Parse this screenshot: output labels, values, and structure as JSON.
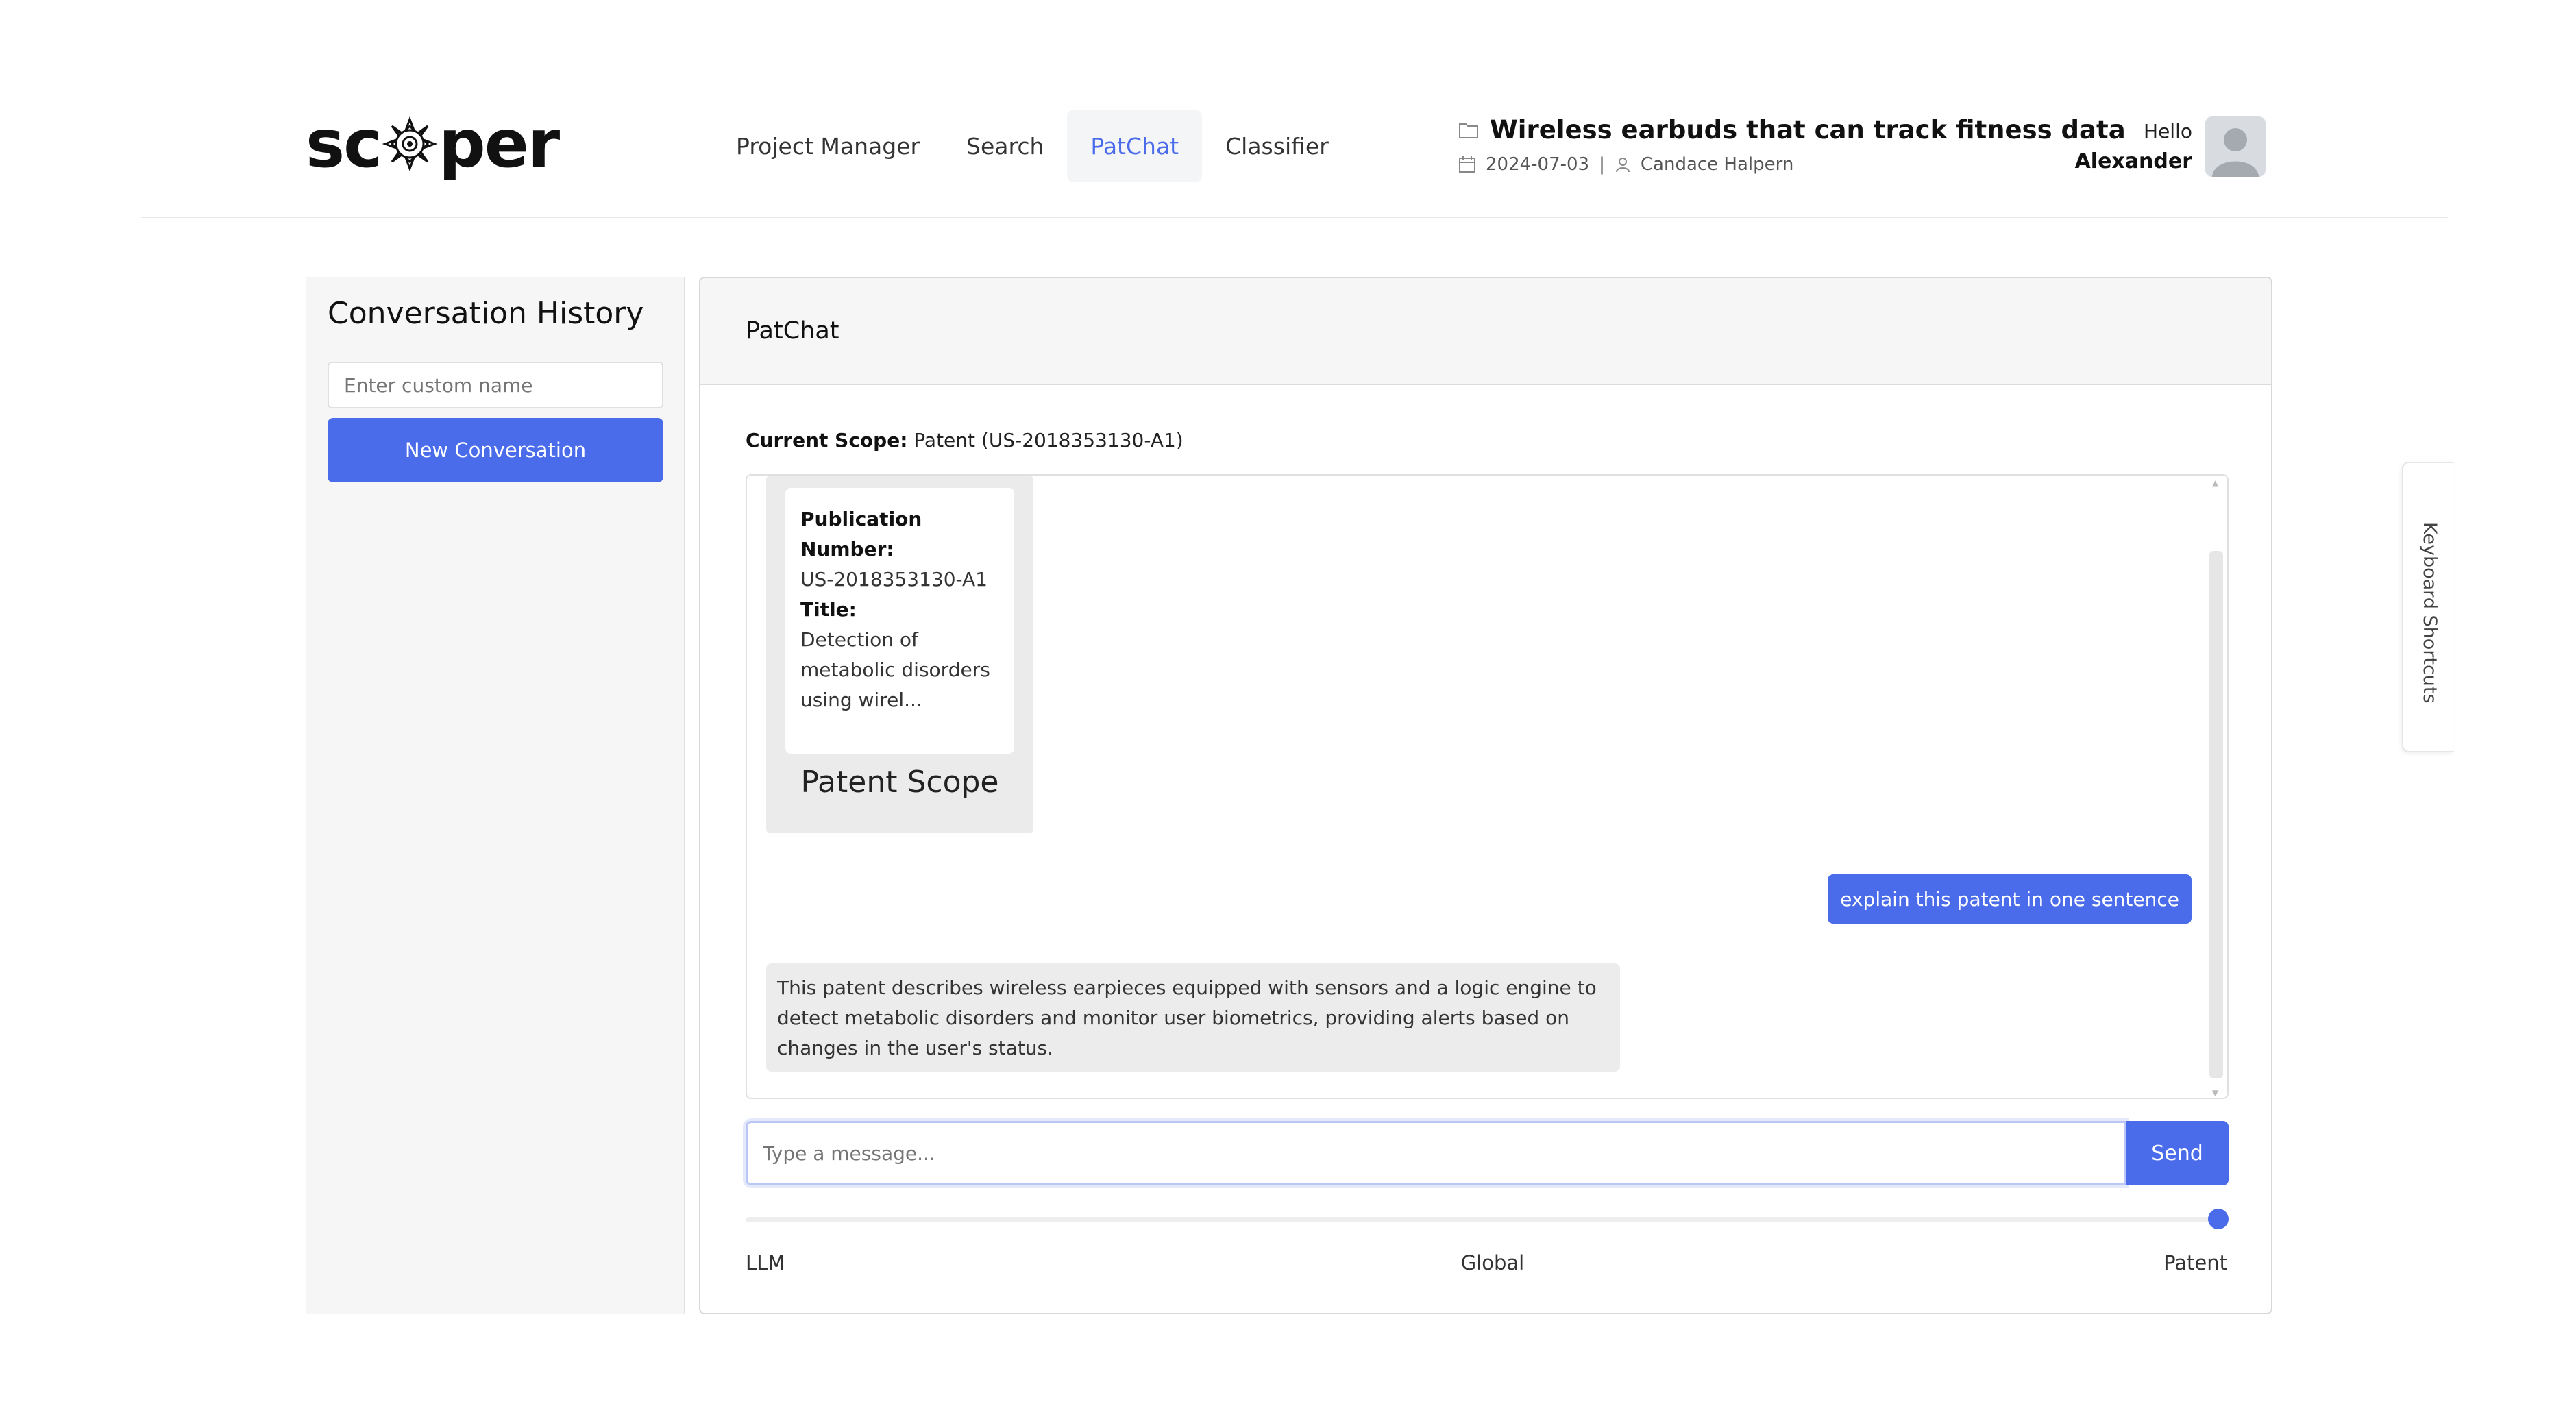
{
  "header": {
    "logo_text_left": "sc",
    "logo_text_right": "per",
    "nav": [
      {
        "label": "Project Manager",
        "active": false
      },
      {
        "label": "Search",
        "active": false
      },
      {
        "label": "PatChat",
        "active": true
      },
      {
        "label": "Classifier",
        "active": false
      }
    ],
    "project": {
      "title": "Wireless earbuds that can track fitness data",
      "date": "2024-07-03",
      "separator": "|",
      "owner": "Candace Halpern"
    },
    "greeting": "Hello",
    "user_name": "Alexander"
  },
  "sidebar": {
    "title": "Conversation History",
    "name_input_placeholder": "Enter custom name",
    "new_conversation_label": "New Conversation"
  },
  "chat": {
    "panel_title": "PatChat",
    "current_scope_label": "Current Scope:",
    "current_scope_value": "Patent (US-2018353130-A1)",
    "scope_card": {
      "pub_label": "Publication Number:",
      "pub_value": "US-2018353130-A1",
      "title_label": "Title:",
      "title_value": "Detection of metabolic disorders using wirel...",
      "caption": "Patent Scope"
    },
    "messages": [
      {
        "role": "user",
        "text": "explain this patent in one sentence"
      },
      {
        "role": "assistant",
        "text": "This patent describes wireless earpieces equipped with sensors and a logic engine to detect metabolic disorders and monitor user biometrics, providing alerts based on changes in the user's status."
      }
    ],
    "input_placeholder": "Type a message...",
    "send_label": "Send",
    "scope_slider": {
      "options": [
        "LLM",
        "Global",
        "Patent"
      ],
      "selected": "Patent"
    }
  },
  "keyboard_shortcuts_label": "Keyboard Shortcuts",
  "colors": {
    "accent": "#4a6bea",
    "panel_header_bg": "#f6f6f6",
    "bot_bubble_bg": "#ececec"
  }
}
